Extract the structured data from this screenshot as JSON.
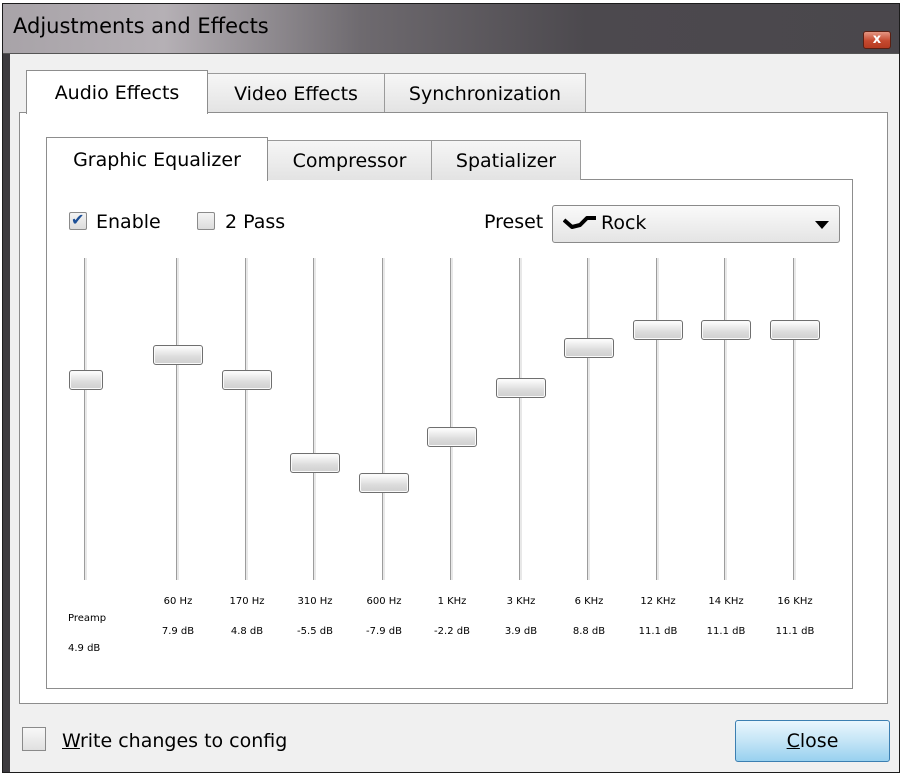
{
  "window": {
    "title": "Adjustments and Effects",
    "close_glyph": "x"
  },
  "tabs": [
    "Audio Effects",
    "Video Effects",
    "Synchronization"
  ],
  "inner_tabs": [
    "Graphic Equalizer",
    "Compressor",
    "Spatializer"
  ],
  "equalizer": {
    "enable_label": "Enable",
    "enable_checked": true,
    "two_pass_label": "2 Pass",
    "two_pass_checked": false,
    "preset_label": "Preset",
    "preset_value": "Rock",
    "preset_icon": "rock-curve-icon",
    "range_db": [
      -20,
      20
    ],
    "preamp": {
      "label": "Preamp",
      "value": "4.9 dB",
      "db": 4.9
    },
    "bands": [
      {
        "freq": "60 Hz",
        "value": "7.9 dB",
        "db": 7.9
      },
      {
        "freq": "170 Hz",
        "value": "4.8 dB",
        "db": 4.8
      },
      {
        "freq": "310 Hz",
        "value": "-5.5 dB",
        "db": -5.5
      },
      {
        "freq": "600 Hz",
        "value": "-7.9 dB",
        "db": -7.9
      },
      {
        "freq": "1 KHz",
        "value": "-2.2 dB",
        "db": -2.2
      },
      {
        "freq": "3 KHz",
        "value": "3.9 dB",
        "db": 3.9
      },
      {
        "freq": "6 KHz",
        "value": "8.8 dB",
        "db": 8.8
      },
      {
        "freq": "12 KHz",
        "value": "11.1 dB",
        "db": 11.1
      },
      {
        "freq": "14 KHz",
        "value": "11.1 dB",
        "db": 11.1
      },
      {
        "freq": "16 KHz",
        "value": "11.1 dB",
        "db": 11.1
      }
    ]
  },
  "footer": {
    "write_config_accel": "W",
    "write_config_rest": "rite changes to config",
    "write_config_checked": false,
    "close_accel": "C",
    "close_rest": "lose"
  },
  "colors": {
    "accent": "#3c7fb1",
    "titlebar_dark": "#4a474c",
    "close_red": "#c64a2f"
  }
}
